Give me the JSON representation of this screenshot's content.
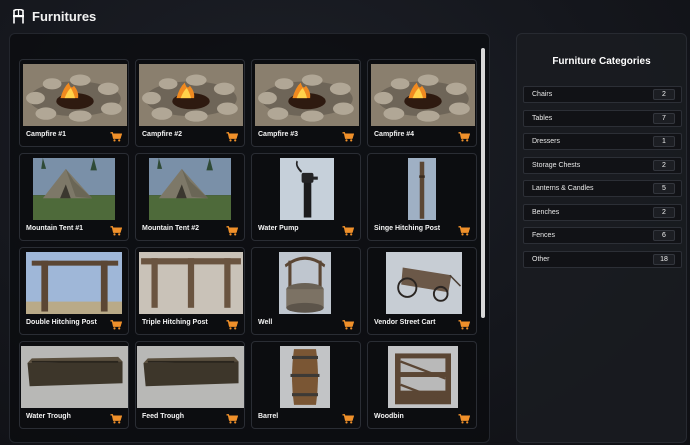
{
  "header": {
    "title": "Furnitures",
    "icon": "chair-icon"
  },
  "grid": {
    "items": [
      {
        "name": "Campfire #1",
        "thumb": "campfire"
      },
      {
        "name": "Campfire #2",
        "thumb": "campfire"
      },
      {
        "name": "Campfire #3",
        "thumb": "campfire"
      },
      {
        "name": "Campfire #4",
        "thumb": "campfire"
      },
      {
        "name": "Mountain Tent #1",
        "thumb": "tent"
      },
      {
        "name": "Mountain Tent #2",
        "thumb": "tent"
      },
      {
        "name": "Water Pump",
        "thumb": "pump"
      },
      {
        "name": "Singe Hitching Post",
        "thumb": "post"
      },
      {
        "name": "Double Hitching Post",
        "thumb": "double-post"
      },
      {
        "name": "Triple Hitching Post",
        "thumb": "triple-post"
      },
      {
        "name": "Well",
        "thumb": "well"
      },
      {
        "name": "Vendor Street Cart",
        "thumb": "cart"
      },
      {
        "name": "Water Trough",
        "thumb": "trough"
      },
      {
        "name": "Feed Trough",
        "thumb": "trough"
      },
      {
        "name": "Barrel",
        "thumb": "barrel"
      },
      {
        "name": "Woodbin",
        "thumb": "woodbin"
      }
    ],
    "cart_icon": "shopping-cart-icon",
    "accent_color": "#f0902a"
  },
  "categories": {
    "title": "Furniture Categories",
    "items": [
      {
        "label": "Chairs",
        "count": "2"
      },
      {
        "label": "Tables",
        "count": "7"
      },
      {
        "label": "Dressers",
        "count": "1"
      },
      {
        "label": "Storage Chests",
        "count": "2"
      },
      {
        "label": "Lanterns & Candles",
        "count": "5"
      },
      {
        "label": "Benches",
        "count": "2"
      },
      {
        "label": "Fences",
        "count": "6"
      },
      {
        "label": "Other",
        "count": "18"
      }
    ]
  }
}
